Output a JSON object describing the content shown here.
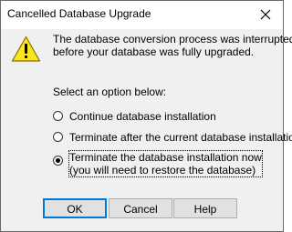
{
  "dialog": {
    "title": "Cancelled Database Upgrade",
    "icon": "warning-icon",
    "message_lines": [
      "The database conversion process was interrupted",
      "before your database was fully upgraded."
    ],
    "prompt": "Select an option below:",
    "options": [
      {
        "lines": [
          "Continue database installation"
        ],
        "selected": false
      },
      {
        "lines": [
          "Terminate after the current database installation"
        ],
        "selected": false
      },
      {
        "lines": [
          "Terminate the database installation now",
          "(you will need to restore the database)"
        ],
        "selected": true
      }
    ],
    "buttons": {
      "ok": "OK",
      "cancel": "Cancel",
      "help": "Help"
    }
  }
}
